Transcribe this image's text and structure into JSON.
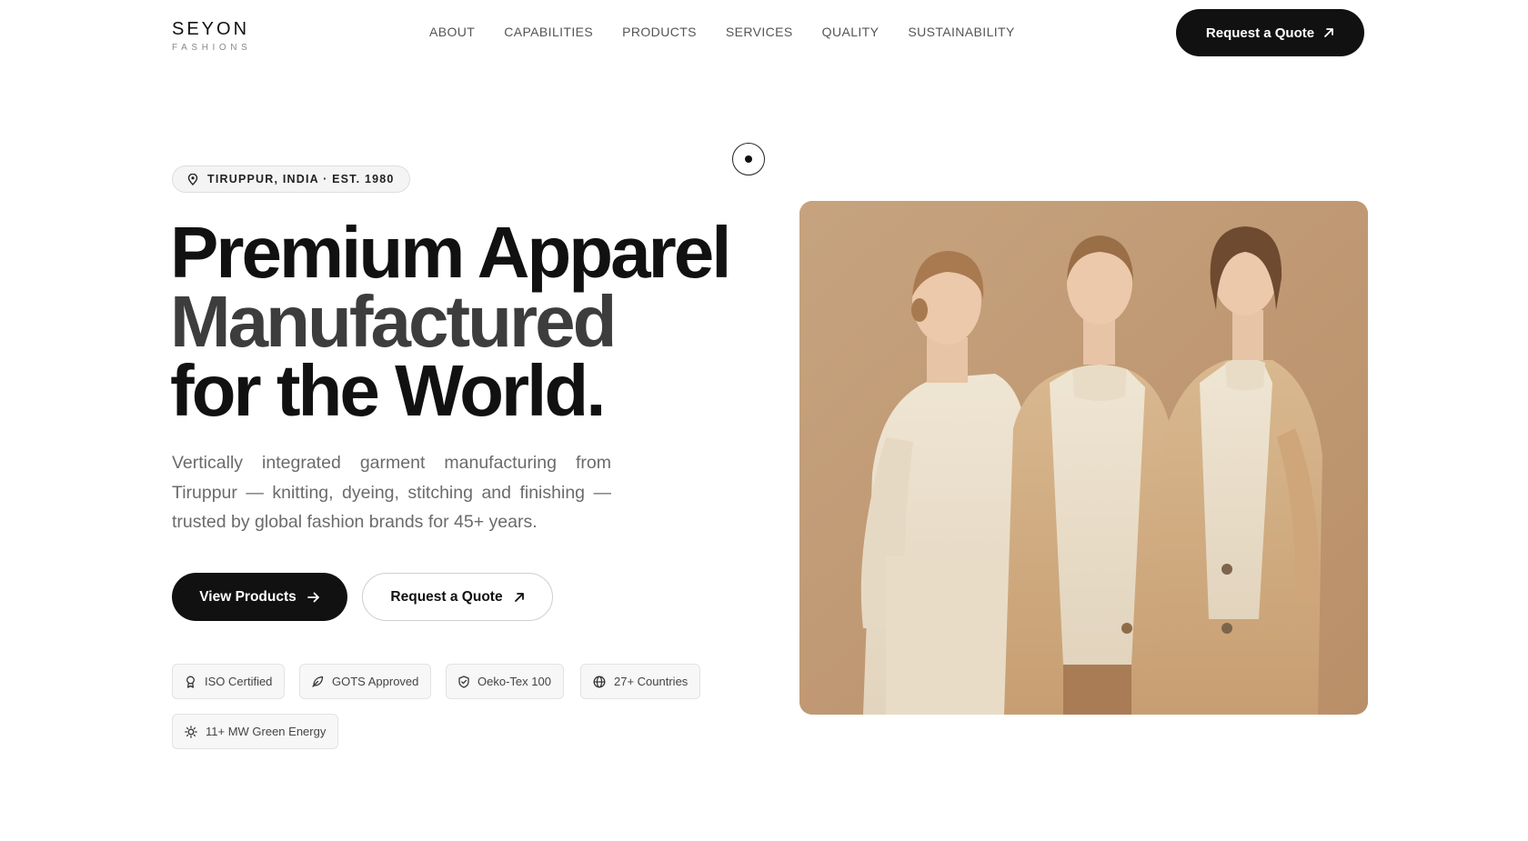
{
  "brand": {
    "name": "SEYON",
    "tagline": "FASHIONS"
  },
  "nav": {
    "items": [
      {
        "label": "ABOUT"
      },
      {
        "label": "CAPABILITIES"
      },
      {
        "label": "PRODUCTS"
      },
      {
        "label": "SERVICES"
      },
      {
        "label": "QUALITY"
      },
      {
        "label": "SUSTAINABILITY"
      }
    ],
    "cta_label": "Request a Quote"
  },
  "hero": {
    "location_badge": "TIRUPPUR, INDIA · EST. 1980",
    "headline_line1": "Premium Apparel",
    "headline_line2": "Manufactured",
    "headline_line3": "for the World",
    "headline_dot": ".",
    "subtext": "Vertically integrated garment manufacturing from Tiruppur — knitting, dyeing, stitching and finishing — trusted by global fashion brands for 45+ years.",
    "primary_button": "View Products",
    "secondary_button": "Request a Quote",
    "chips": [
      {
        "label": "ISO Certified",
        "icon": "award-icon"
      },
      {
        "label": "GOTS Approved",
        "icon": "leaf-icon"
      },
      {
        "label": "Oeko-Tex 100",
        "icon": "shield-check-icon"
      },
      {
        "label": "27+ Countries",
        "icon": "globe-icon"
      },
      {
        "label": "11+ MW Green Energy",
        "icon": "sun-icon"
      }
    ]
  },
  "colors": {
    "primary": "#111111",
    "image_backdrop": "#c9a683"
  }
}
